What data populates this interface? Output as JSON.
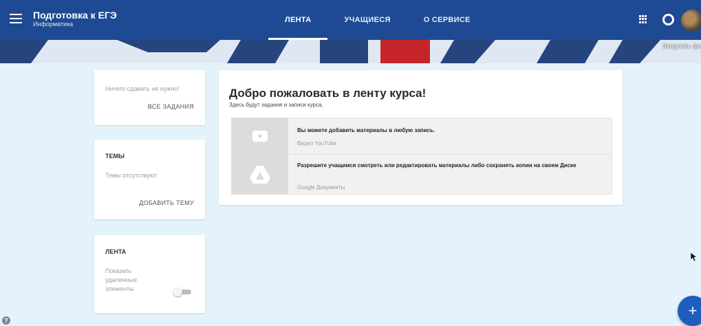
{
  "header": {
    "title": "Подготовка к ЕГЭ",
    "subtitle": "Информатика",
    "tabs": [
      {
        "label": "ЛЕНТА",
        "active": true
      },
      {
        "label": "УЧАЩИЕСЯ",
        "active": false
      },
      {
        "label": "О СЕРВИСЕ",
        "active": false
      }
    ],
    "accent": "#1e4a93"
  },
  "banner": {
    "link": "Загрузить фо"
  },
  "sidebar": {
    "due": {
      "text": "Ничего сдавать не нужно!",
      "link": "ВСЕ ЗАДАНИЯ"
    },
    "topics": {
      "title": "ТЕМЫ",
      "empty": "Темы отсутствуют",
      "link": "ДОБАВИТЬ ТЕМУ"
    },
    "feed": {
      "title": "ЛЕНТА",
      "option": "Показать удаленные элементы",
      "toggle_on": false
    }
  },
  "main": {
    "welcome_title": "Добро пожаловать в ленту курса!",
    "welcome_subtitle": "Здесь будут задания и записи курса.",
    "materials": [
      {
        "icon": "youtube-icon",
        "text": "Вы можете добавить материалы в любую запись.",
        "source": "Видео YouTube"
      },
      {
        "icon": "drive-icon",
        "text": "Разрешите учащимся смотреть или редактировать материалы либо сохранять копии на своем Диске",
        "source": "Google Документы"
      }
    ]
  },
  "fab": {
    "label": "+"
  },
  "help": {
    "label": "?"
  }
}
